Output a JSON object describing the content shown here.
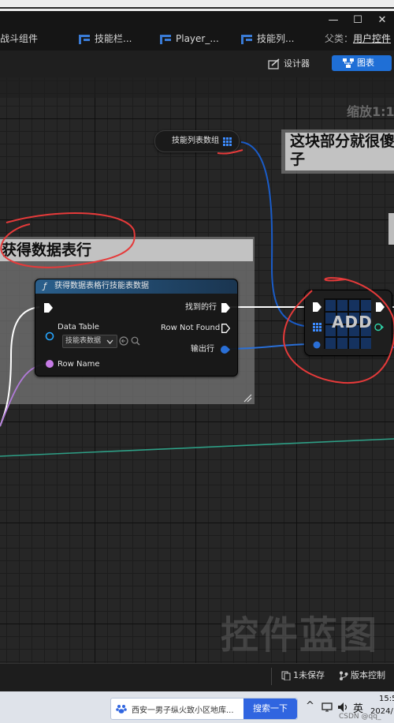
{
  "tabs": [
    {
      "label": "战斗组件"
    },
    {
      "label": "技能栏..."
    },
    {
      "label": "Player_..."
    },
    {
      "label": "技能列..."
    }
  ],
  "window": {
    "minimize": "—",
    "maximize": "☐",
    "close": "✕"
  },
  "parent_class": {
    "label": "父类：",
    "value": "用户控件"
  },
  "toolbar": {
    "designer_label": "设计器",
    "graph_label": "图表"
  },
  "canvas": {
    "zoom_label": "缩放1:1",
    "watermark": "控件蓝图"
  },
  "comments": {
    "right_title": "这块部分就很傻子",
    "right_title_line1": "这块部分就很傻",
    "right_title_line2": "子",
    "left_title": "获得数据表行"
  },
  "nodes": {
    "array_var": {
      "label": "技能列表数组"
    },
    "get_row": {
      "title": "获得数据表格行技能表数据",
      "pin_data_table": "Data Table",
      "data_table_value": "技能表数据",
      "pin_row_name": "Row Name",
      "pin_found": "找到的行",
      "pin_not_found": "Row Not Found",
      "pin_out_row": "输出行"
    },
    "add": {
      "label": "ADD"
    }
  },
  "status": {
    "unsaved": "1未保存",
    "source_control": "版本控制"
  },
  "taskbar": {
    "news_text": "西安一男子纵火致小区地库...",
    "search_button": "搜索一下",
    "ime": "英",
    "time": "15:5",
    "date": "2024/",
    "watermark": "CSDN @qq_"
  },
  "colors": {
    "exec_wire": "#ffffff",
    "array_wire": "#1a5cc8",
    "struct_wire": "#2a6fd6",
    "name_pin": "#c67be6",
    "teal_wire": "#2e9f86",
    "annotation_red": "#e53a3a",
    "graph_tab_active": "#1f6fd6"
  }
}
